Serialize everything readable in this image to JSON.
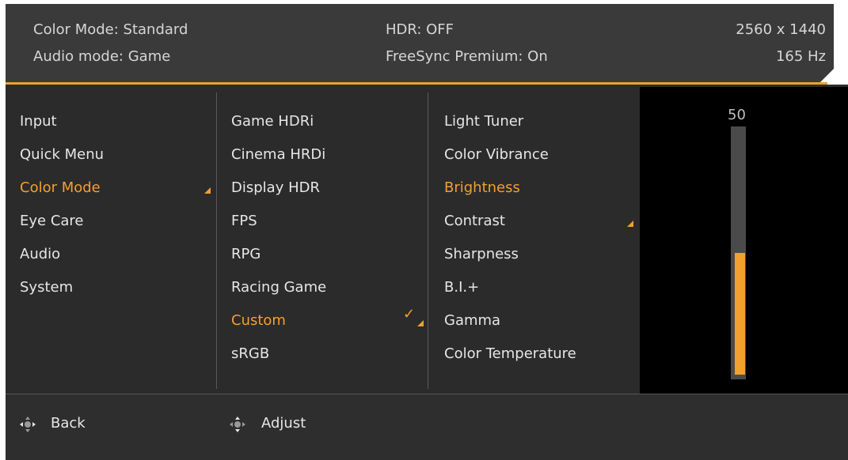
{
  "header": {
    "color_mode": "Color Mode: Standard",
    "audio_mode": "Audio mode: Game",
    "hdr": "HDR: OFF",
    "freesync": "FreeSync Premium: On",
    "resolution": "2560 x 1440",
    "refresh": "165 Hz"
  },
  "menu": {
    "col1": [
      "Input",
      "Quick Menu",
      "Color Mode",
      "Eye Care",
      "Audio",
      "System"
    ],
    "col1_active_index": 2,
    "col2": [
      "Game HDRi",
      "Cinema HRDi",
      "Display HDR",
      "FPS",
      "RPG",
      "Racing Game",
      "Custom",
      "sRGB"
    ],
    "col2_active_index": 6,
    "col2_checked_index": 6,
    "col3": [
      "Light Tuner",
      "Color Vibrance",
      "Brightness",
      "Contrast",
      "Sharpness",
      "B.I.+",
      "Gamma",
      "Color Temperature"
    ],
    "col3_active_index": 2
  },
  "slider": {
    "label": "50",
    "level": 0.5
  },
  "footer": {
    "back": "Back",
    "adjust": "Adjust"
  },
  "colors": {
    "accent": "#f2a02e",
    "panel": "#2b2b2b",
    "header": "#3a3a3a"
  }
}
